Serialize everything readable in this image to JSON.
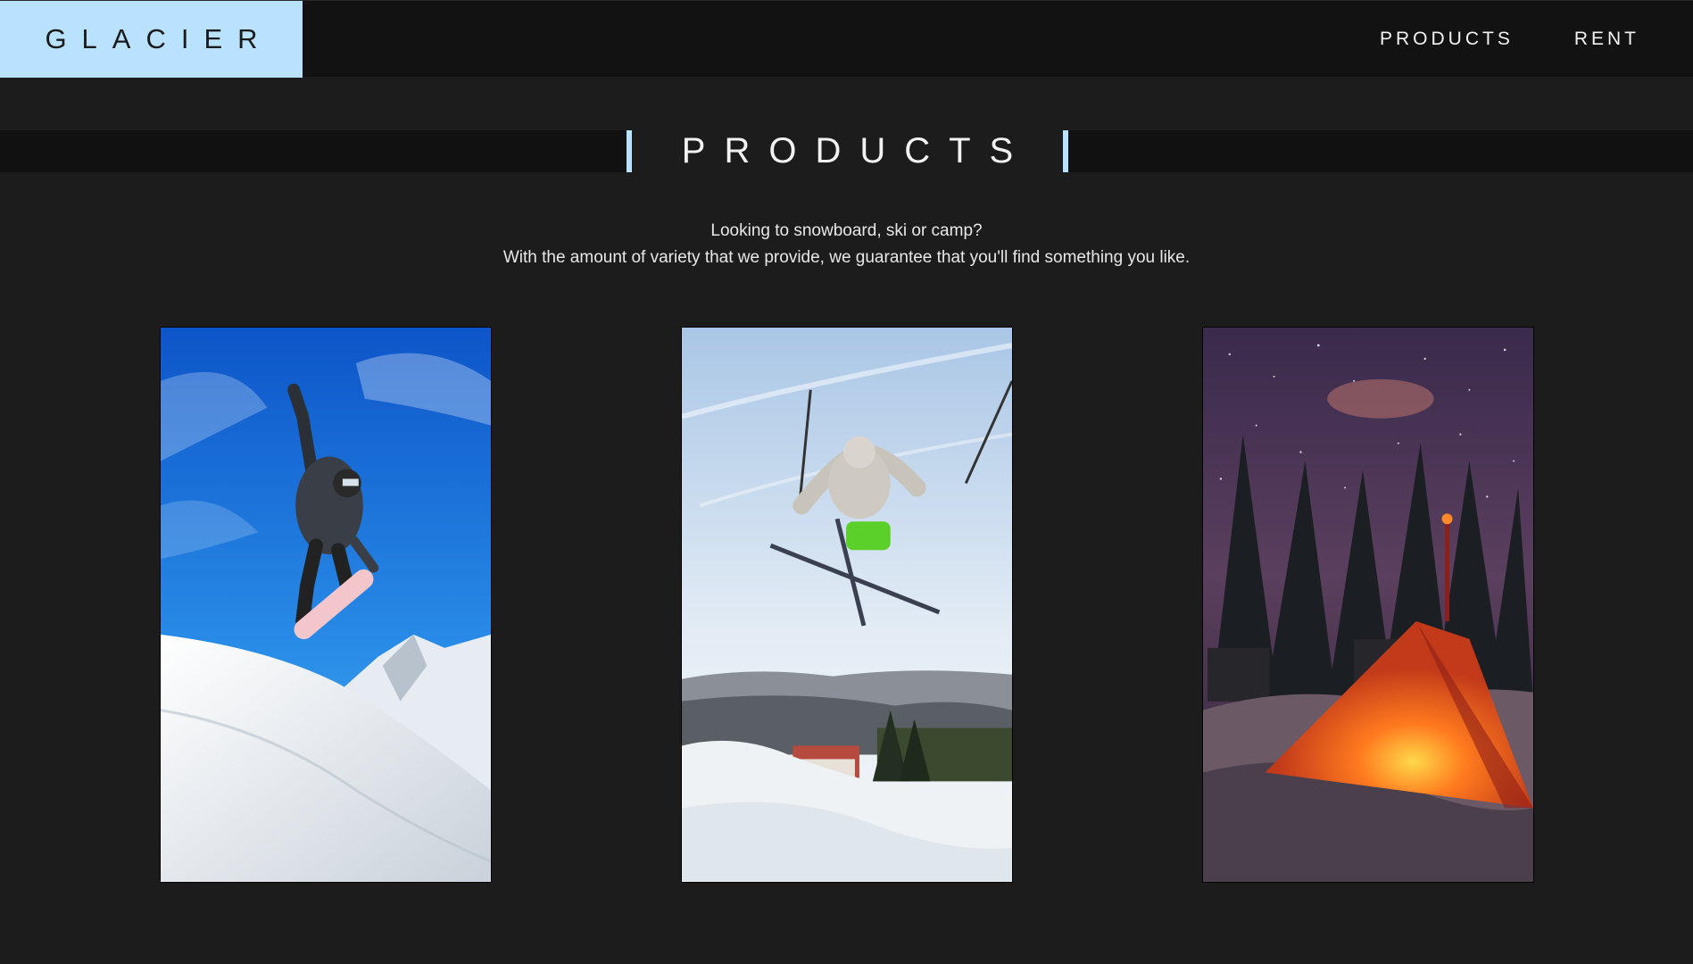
{
  "header": {
    "logo": "GLACIER",
    "nav": [
      {
        "label": "PRODUCTS"
      },
      {
        "label": "RENT"
      }
    ]
  },
  "section": {
    "title": "PRODUCTS",
    "intro_line1": "Looking to snowboard, ski or camp?",
    "intro_line2": "With the amount of variety that we provide, we guarantee that you'll find something you like."
  },
  "products": [
    {
      "icon": "snowboard-photo"
    },
    {
      "icon": "ski-photo"
    },
    {
      "icon": "camping-photo"
    }
  ],
  "colors": {
    "accent": "#b8e2ff",
    "background": "#1c1c1c",
    "header": "#121212"
  }
}
